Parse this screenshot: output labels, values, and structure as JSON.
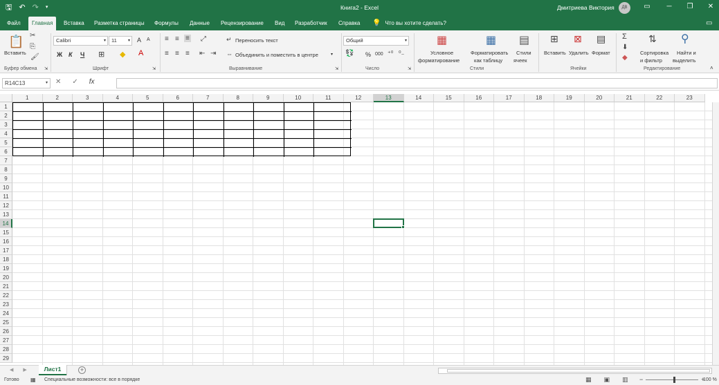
{
  "titlebar": {
    "doc_title": "Книга2 - Excel",
    "user": "Дмитриева Виктория",
    "avatar_initials": "ДВ",
    "qat": {
      "save": "🖫",
      "undo": "↶",
      "redo": "↷",
      "customize": "▾"
    }
  },
  "tabs": [
    {
      "label": "Файл"
    },
    {
      "label": "Главная"
    },
    {
      "label": "Вставка"
    },
    {
      "label": "Разметка страницы"
    },
    {
      "label": "Формулы"
    },
    {
      "label": "Данные"
    },
    {
      "label": "Рецензирование"
    },
    {
      "label": "Вид"
    },
    {
      "label": "Разработчик"
    },
    {
      "label": "Справка"
    }
  ],
  "tell_me": "Что вы хотите сделать?",
  "ribbon": {
    "clipboard": {
      "paste": "Вставить",
      "label": "Буфер обмена"
    },
    "font": {
      "name": "Calibri",
      "size": "11",
      "bold": "Ж",
      "italic": "К",
      "underline": "Ч",
      "grow": "A",
      "shrink": "A",
      "label": "Шрифт"
    },
    "alignment": {
      "wrap": "Переносить текст",
      "merge": "Объединить и поместить в центре",
      "label": "Выравнивание"
    },
    "number": {
      "format": "Общий",
      "percent": "%",
      "thousands": "000",
      "label": "Число"
    },
    "styles": {
      "conditional_1": "Условное",
      "conditional_2": "форматирование",
      "table_1": "Форматировать",
      "table_2": "как таблицу",
      "cell_1": "Стили",
      "cell_2": "ячеек",
      "label": "Стили"
    },
    "cells": {
      "insert": "Вставить",
      "delete": "Удалить",
      "format": "Формат",
      "label": "Ячейки"
    },
    "editing": {
      "sort_1": "Сортировка",
      "sort_2": "и фильтр",
      "find_1": "Найти и",
      "find_2": "выделить",
      "label": "Редактирование"
    }
  },
  "formula_bar": {
    "name_box": "R14C13",
    "fx": "fx",
    "cancel": "✕",
    "enter": "✓",
    "value": ""
  },
  "grid": {
    "columns": [
      "1",
      "2",
      "3",
      "4",
      "5",
      "6",
      "7",
      "8",
      "9",
      "10",
      "11",
      "12",
      "13",
      "14",
      "15",
      "16",
      "17",
      "18",
      "19",
      "20",
      "21",
      "22",
      "23"
    ],
    "rows": [
      "1",
      "2",
      "3",
      "4",
      "5",
      "6",
      "7",
      "8",
      "9",
      "10",
      "11",
      "12",
      "13",
      "14",
      "15",
      "16",
      "17",
      "18",
      "19",
      "20",
      "21",
      "22",
      "23",
      "24",
      "25",
      "26",
      "27",
      "28",
      "29"
    ],
    "selected_column": "13",
    "selected_row": "14"
  },
  "sheets": [
    {
      "label": "Лист1"
    }
  ],
  "statusbar": {
    "ready": "Готово",
    "accessibility": "Специальные возможности: все в порядке",
    "zoom": "100 %"
  }
}
